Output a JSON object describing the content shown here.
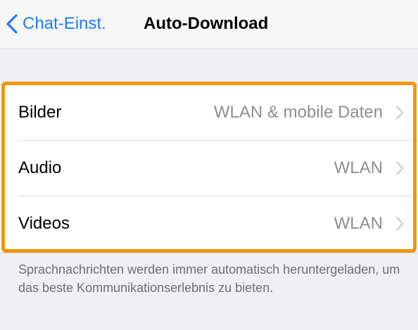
{
  "navbar": {
    "back_label": "Chat-Einst.",
    "title": "Auto-Download"
  },
  "settings": {
    "rows": [
      {
        "label": "Bilder",
        "value": "WLAN & mobile Daten"
      },
      {
        "label": "Audio",
        "value": "WLAN"
      },
      {
        "label": "Videos",
        "value": "WLAN"
      }
    ]
  },
  "footer": {
    "note": "Sprachnachrichten werden immer automatisch heruntergeladen, um das beste Kommunikationserlebnis zu bieten."
  },
  "colors": {
    "accent_blue": "#1f7cf6",
    "highlight_orange": "#f4940a",
    "background": "#efeff4",
    "secondary_text": "#8e8e93"
  },
  "icons": {
    "back": "chevron-left-icon",
    "row_disclosure": "chevron-right-icon"
  }
}
